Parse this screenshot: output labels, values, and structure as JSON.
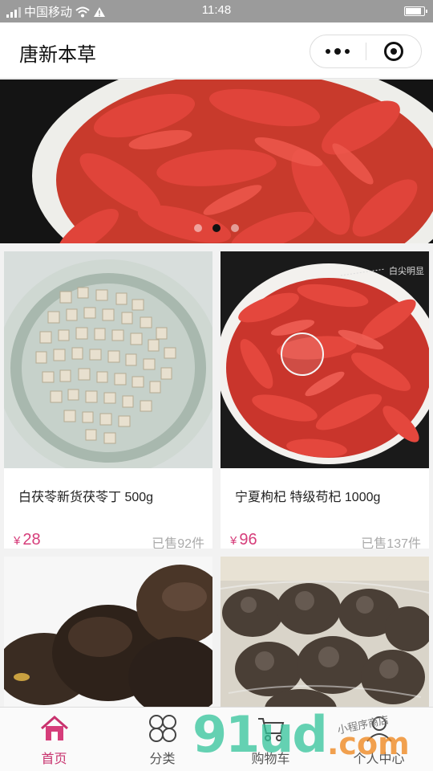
{
  "status_bar": {
    "carrier": "中国移动",
    "time": "11:48"
  },
  "header": {
    "title": "唐新本草"
  },
  "banner": {
    "image": "goji-berries-in-bowl",
    "dots": 3,
    "active_dot": 2
  },
  "products": [
    {
      "image": "poria-cubes-on-plate",
      "name": "白茯苓新货茯苓丁 500g",
      "currency": "¥",
      "price": "28",
      "sold": "已售92件"
    },
    {
      "image": "goji-berries-bowl",
      "name": "宁夏枸杞 特级苟杞 1000g",
      "currency": "¥",
      "price": "96",
      "sold": "已售137件",
      "annotation": "白尖明显"
    },
    {
      "image": "dried-mushroom-pieces",
      "name": "",
      "currency": "",
      "price": "",
      "sold": ""
    },
    {
      "image": "dried-tubers-in-bag",
      "name": "",
      "currency": "",
      "price": "",
      "sold": ""
    }
  ],
  "tabbar": {
    "items": [
      {
        "label": "首页",
        "icon": "home-icon",
        "active": true
      },
      {
        "label": "分类",
        "icon": "category-icon",
        "active": false
      },
      {
        "label": "购物车",
        "icon": "cart-icon",
        "active": false
      },
      {
        "label": "个人中心",
        "icon": "profile-icon",
        "active": false
      }
    ]
  },
  "watermark": {
    "brand": "91ud",
    "suffix": ".com",
    "handwriting": "小程序商店"
  },
  "colors": {
    "accent": "#d63d7a",
    "status_bar": "#9b9b9b"
  }
}
